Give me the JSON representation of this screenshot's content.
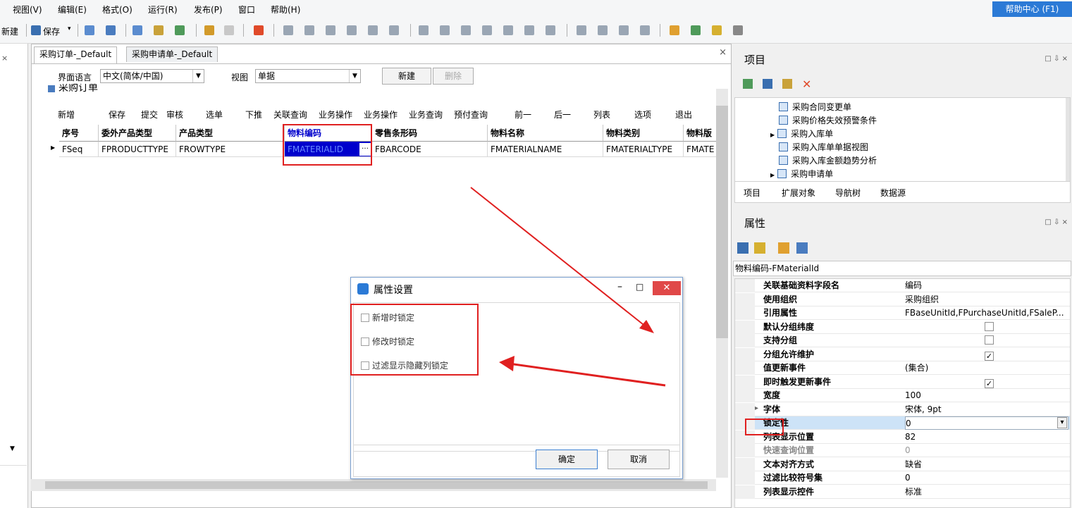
{
  "menu": [
    "视图(V)",
    "编辑(E)",
    "格式(O)",
    "运行(R)",
    "发布(P)",
    "窗口",
    "帮助(H)"
  ],
  "help_center": "帮助中心 (F1)",
  "toolbar": {
    "new_label": "新建",
    "save_label": "保存"
  },
  "left_pane": {
    "close": "× "
  },
  "tabs": [
    "采购订单-_Default",
    "采购申请单-_Default"
  ],
  "designer": {
    "lang_label": "界面语言",
    "lang_value": "中文(简体/中国)",
    "view_label": "视图",
    "view_value": "单据",
    "new_btn": "新建",
    "delete_btn": "删除",
    "form_title": "采购订单"
  },
  "bill_toolbar": [
    "新增",
    "保存",
    "提交",
    "审核",
    "选单",
    "下推",
    "关联查询",
    "业务操作",
    "业务操作",
    "业务查询",
    "预付查询",
    "前一",
    "后一",
    "列表",
    "选项",
    "退出"
  ],
  "grid": {
    "headers": [
      "序号",
      "委外产品类型",
      "产品类型",
      "物料编码",
      "零售条形码",
      "物料名称",
      "物料类别",
      "物料版"
    ],
    "row": [
      "FSeq",
      "FPRODUCTTYPE",
      "FROWTYPE",
      "FMATERIALID",
      "FBARCODE",
      "FMATERIALNAME",
      "FMATERIALTYPE",
      "FMATE"
    ]
  },
  "project_panel": {
    "title": "项目",
    "tree": [
      "采购合同变更单",
      "采购价格失效预警条件",
      "采购入库单",
      "采购入库单单据视图",
      "采购入库金额趋势分析",
      "采购申请单"
    ],
    "tabs": [
      "项目",
      "扩展对象",
      "导航树",
      "数据源"
    ]
  },
  "property_panel": {
    "title": "属性",
    "selected_object": "物料编码-FMaterialId",
    "rows": [
      {
        "name": "关联基础资料字段名",
        "value": "编码",
        "checkbox": false
      },
      {
        "name": "使用组织",
        "value": "采购组织",
        "checkbox": false
      },
      {
        "name": "引用属性",
        "value": "FBaseUnitId,FPurchaseUnitId,FSaleP...",
        "checkbox": false
      },
      {
        "name": "默认分组纬度",
        "value": "",
        "checkbox": true,
        "checked": false
      },
      {
        "name": "支持分组",
        "value": "",
        "checkbox": true,
        "checked": false
      },
      {
        "name": "分组允许维护",
        "value": "",
        "checkbox": true,
        "checked": true
      },
      {
        "name": "值更新事件",
        "value": "(集合)",
        "checkbox": false
      },
      {
        "name": "即时触发更新事件",
        "value": "",
        "checkbox": true,
        "checked": true
      },
      {
        "name": "宽度",
        "value": "100",
        "checkbox": false
      },
      {
        "name": "字体",
        "value": "宋体, 9pt",
        "checkbox": false
      },
      {
        "name": "锁定性",
        "value": "0",
        "checkbox": false
      },
      {
        "name": "列表显示位置",
        "value": "82",
        "checkbox": false
      },
      {
        "name": "快速查询位置",
        "value": "0",
        "checkbox": false
      },
      {
        "name": "文本对齐方式",
        "value": "缺省",
        "checkbox": false
      },
      {
        "name": "过滤比较符号集",
        "value": "0",
        "checkbox": false
      },
      {
        "name": "列表显示控件",
        "value": "标准",
        "checkbox": false
      }
    ]
  },
  "dialog": {
    "title": "属性设置",
    "options": [
      {
        "label": "新增时锁定",
        "checked": false
      },
      {
        "label": "修改时锁定",
        "checked": false
      },
      {
        "label": "过滤显示隐藏列锁定",
        "checked": false
      }
    ],
    "ok": "确定",
    "cancel": "取消"
  },
  "colors": {
    "accent": "#2b7ad6",
    "selection": "#0000cc",
    "highlight": "#e02020",
    "selected_row": "#cde3f7"
  }
}
